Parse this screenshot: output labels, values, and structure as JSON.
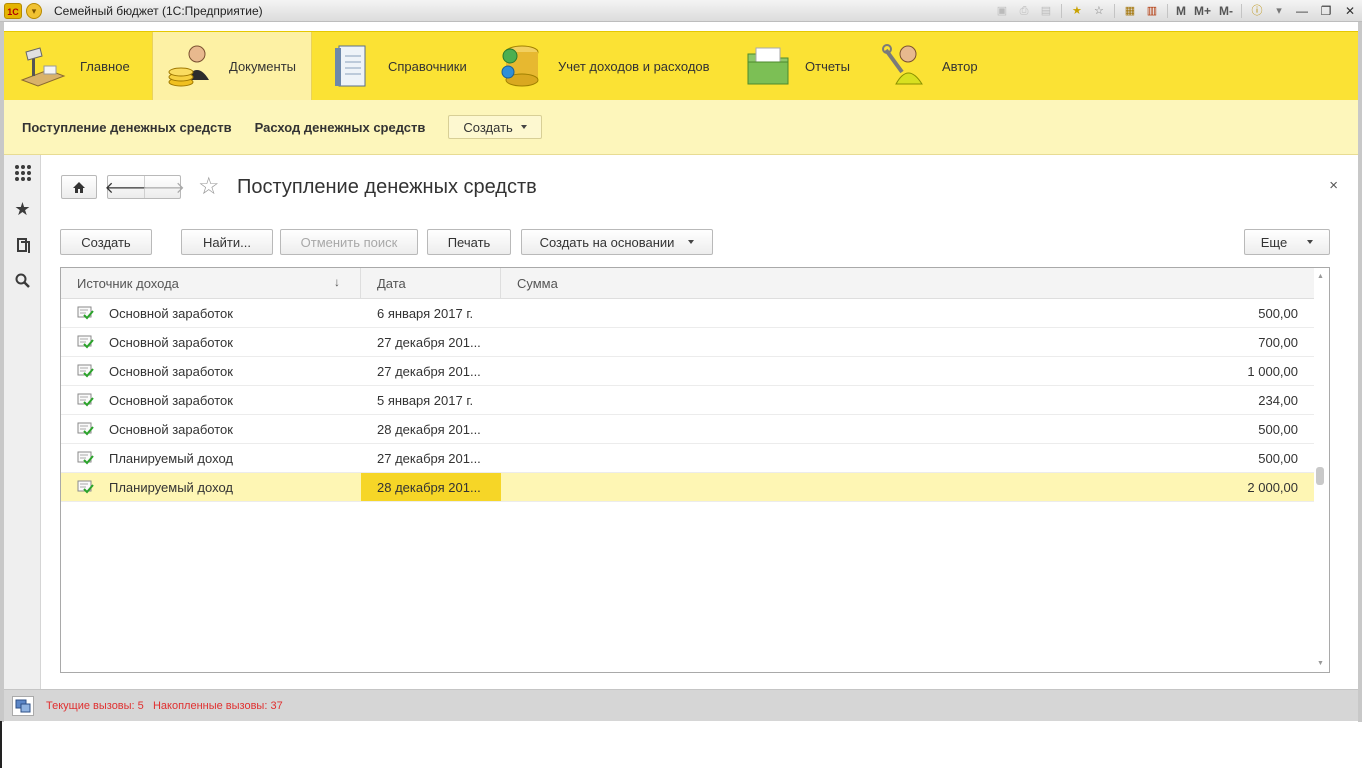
{
  "window": {
    "title": "Семейный бюджет  (1С:Предприятие)",
    "logo": "1С",
    "right_controls": [
      "M",
      "M+",
      "M-"
    ]
  },
  "sections": [
    {
      "label": "Главное",
      "icon": "home-desk-icon",
      "active": false
    },
    {
      "label": "Документы",
      "icon": "person-coins-icon",
      "active": true
    },
    {
      "label": "Справочники",
      "icon": "reference-book-icon",
      "active": false
    },
    {
      "label": "Учет доходов и расходов",
      "icon": "database-coins-icon",
      "active": false
    },
    {
      "label": "Отчеты",
      "icon": "folder-report-icon",
      "active": false
    },
    {
      "label": "Автор",
      "icon": "author-tools-icon",
      "active": false
    }
  ],
  "function_panel": {
    "links": [
      "Поступление денежных средств",
      "Расход денежных средств"
    ],
    "create_label": "Создать"
  },
  "form": {
    "title": "Поступление денежных средств",
    "close": "×",
    "buttons": {
      "create": "Создать",
      "find": "Найти...",
      "cancel_search": "Отменить поиск",
      "print": "Печать",
      "create_based": "Создать на основании",
      "more": "Еще"
    }
  },
  "table": {
    "columns": [
      "Источник дохода",
      "Дата",
      "Сумма"
    ],
    "sort_indicator": "↓",
    "rows": [
      {
        "source": "Основной заработок",
        "date": "6 января 2017 г.",
        "amount": "500,00"
      },
      {
        "source": "Основной заработок",
        "date": "27 декабря 201...",
        "amount": "700,00"
      },
      {
        "source": "Основной заработок",
        "date": "27 декабря 201...",
        "amount": "1 000,00"
      },
      {
        "source": "Основной заработок",
        "date": "5 января 2017 г.",
        "amount": "234,00"
      },
      {
        "source": "Основной заработок",
        "date": "28 декабря 201...",
        "amount": "500,00"
      },
      {
        "source": "Планируемый доход",
        "date": "27 декабря 201...",
        "amount": "500,00"
      },
      {
        "source": "Планируемый доход",
        "date": "28 декабря 201...",
        "amount": "2 000,00",
        "selected": true
      }
    ]
  },
  "status_bar": {
    "text": "Текущие вызовы: 5   Накопленные вызовы: 37"
  },
  "colors": {
    "section_panel": "#fbe234",
    "function_panel": "#fdf6bb",
    "selected_row": "#fef6b4",
    "selected_cell": "#f6d627",
    "status_text": "#e03030"
  }
}
